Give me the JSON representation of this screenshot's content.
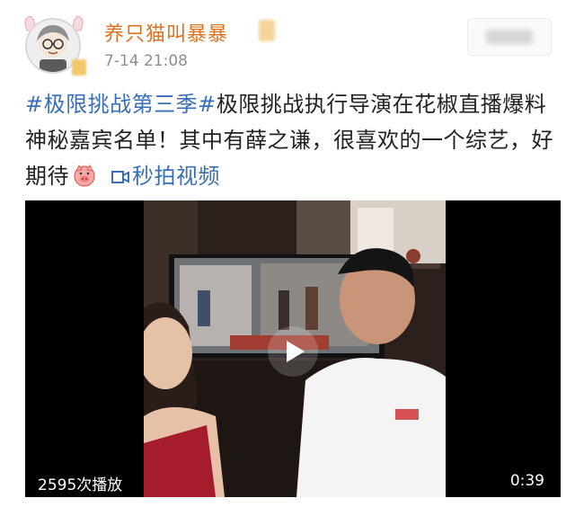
{
  "post": {
    "username": "养只猫叫暴暴",
    "timestamp": "7-14 21:08",
    "topic": "#极限挑战第三季#",
    "body_part1": "极限挑战执行导演在花椒直播爆料神秘嘉宾名单！其中有薛之谦，很喜欢的一个综艺，好期待",
    "video_link_label": "秒拍视频",
    "emoji_icon": "pig-face-icon",
    "video_link_icon": "video-link-icon"
  },
  "video": {
    "play_count": "2595次播放",
    "duration": "0:39",
    "play_icon": "play-icon"
  },
  "colors": {
    "username": "#e2711d",
    "topic": "#3a6fb5",
    "text": "#222222",
    "meta": "#8e8e8e"
  }
}
